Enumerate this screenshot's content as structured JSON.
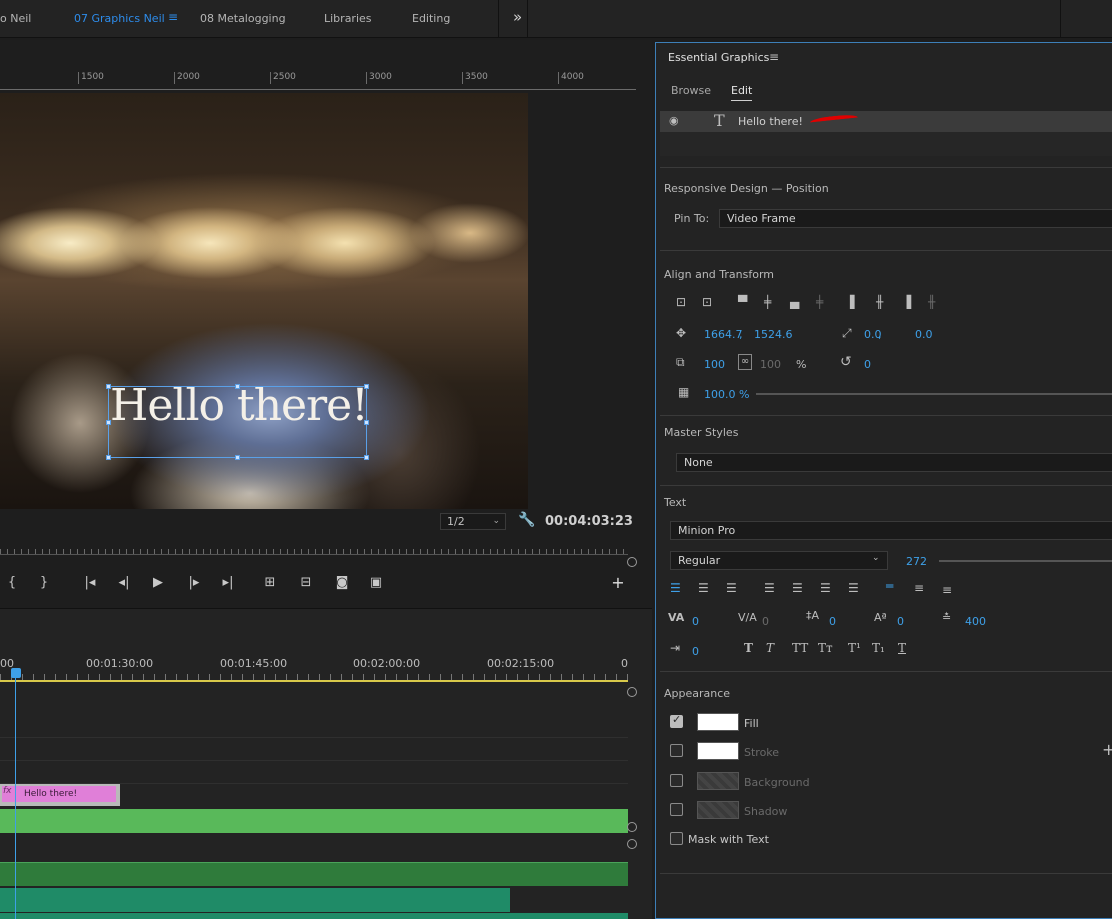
{
  "workspace_tabs": [
    {
      "label": "o Neil"
    },
    {
      "label": "07 Graphics Neil"
    },
    {
      "label": "08 Metalogging"
    },
    {
      "label": "Libraries"
    },
    {
      "label": "Editing"
    }
  ],
  "workspace_menu_glyph": "≡",
  "workspace_overflow": "»",
  "monitor": {
    "ruler_labels": [
      "1500",
      "2000",
      "2500",
      "3000",
      "3500",
      "4000"
    ],
    "overlay_text": "Hello there!",
    "resolution": "1/2",
    "timecode": "00:04:03:23",
    "add_button": "+"
  },
  "timeline": {
    "ruler": [
      "00",
      "00:01:30:00",
      "00:01:45:00",
      "00:02:00:00",
      "00:02:15:00",
      "0"
    ],
    "title_clip": {
      "fx": "fx",
      "name": "Hello there!"
    }
  },
  "essential_graphics": {
    "title": "Essential Graphics",
    "menu_glyph": "≡",
    "tabs": [
      "Browse",
      "Edit"
    ],
    "layer": {
      "name": "Hello there!"
    },
    "responsive_design": {
      "heading": "Responsive Design — Position",
      "pin_label": "Pin To:",
      "pin_value": "Video Frame"
    },
    "align_transform": {
      "heading": "Align and Transform",
      "position_x": "1664.7",
      "position_y": "1524.6",
      "comma": ",",
      "anchor_x": "0.0",
      "anchor_y": "0.0",
      "scale": "100",
      "scale_h": "100",
      "percent": "%",
      "rotation": "0",
      "opacity": "100.0 %"
    },
    "master_styles": {
      "heading": "Master Styles",
      "value": "None"
    },
    "text": {
      "heading": "Text",
      "font": "Minion Pro",
      "style": "Regular",
      "size": "272",
      "kerning": "0",
      "tracking": "0",
      "leading": "0",
      "baseline": "0",
      "tsume": "400",
      "tab_width": "0"
    },
    "appearance": {
      "heading": "Appearance",
      "items": [
        {
          "label": "Fill",
          "checked": true
        },
        {
          "label": "Stroke",
          "checked": false
        },
        {
          "label": "Background",
          "checked": false
        },
        {
          "label": "Shadow",
          "checked": false
        }
      ],
      "mask_label": "Mask with Text",
      "add_glyph": "+"
    }
  },
  "colors": {
    "accent_blue": "#2d8ceb",
    "title_clip": "#e07fd8",
    "video_clip": "#59b95a",
    "audio_clip": "#1f8b67",
    "work_area": "#d8c94a"
  }
}
